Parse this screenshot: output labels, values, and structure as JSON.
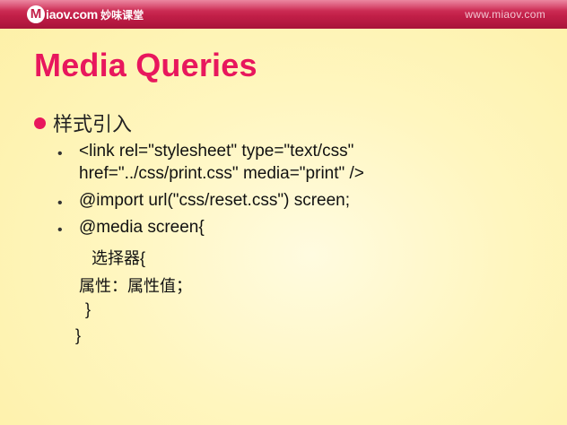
{
  "header": {
    "logo_mark": "M",
    "logo_text": "iaov.com",
    "logo_cn": "妙味课堂",
    "site_url": "www.miaov.com"
  },
  "slide": {
    "title": "Media Queries",
    "section": "样式引入",
    "bullets": {
      "b1": {
        "line1": "<link rel=\"stylesheet\" type=\"text/css\"",
        "line2": "href=\"../css/print.css\" media=\"print\" />"
      },
      "b2": "@import url(\"css/reset.css\") screen;",
      "b3": "@media screen{"
    },
    "code": {
      "selector": "选择器{",
      "property": "属性：属性值；",
      "close_inner": "}",
      "close_outer": "}"
    }
  },
  "colors": {
    "accent": "#e8175d",
    "header": "#c21f48",
    "background": "#fff6bf"
  }
}
